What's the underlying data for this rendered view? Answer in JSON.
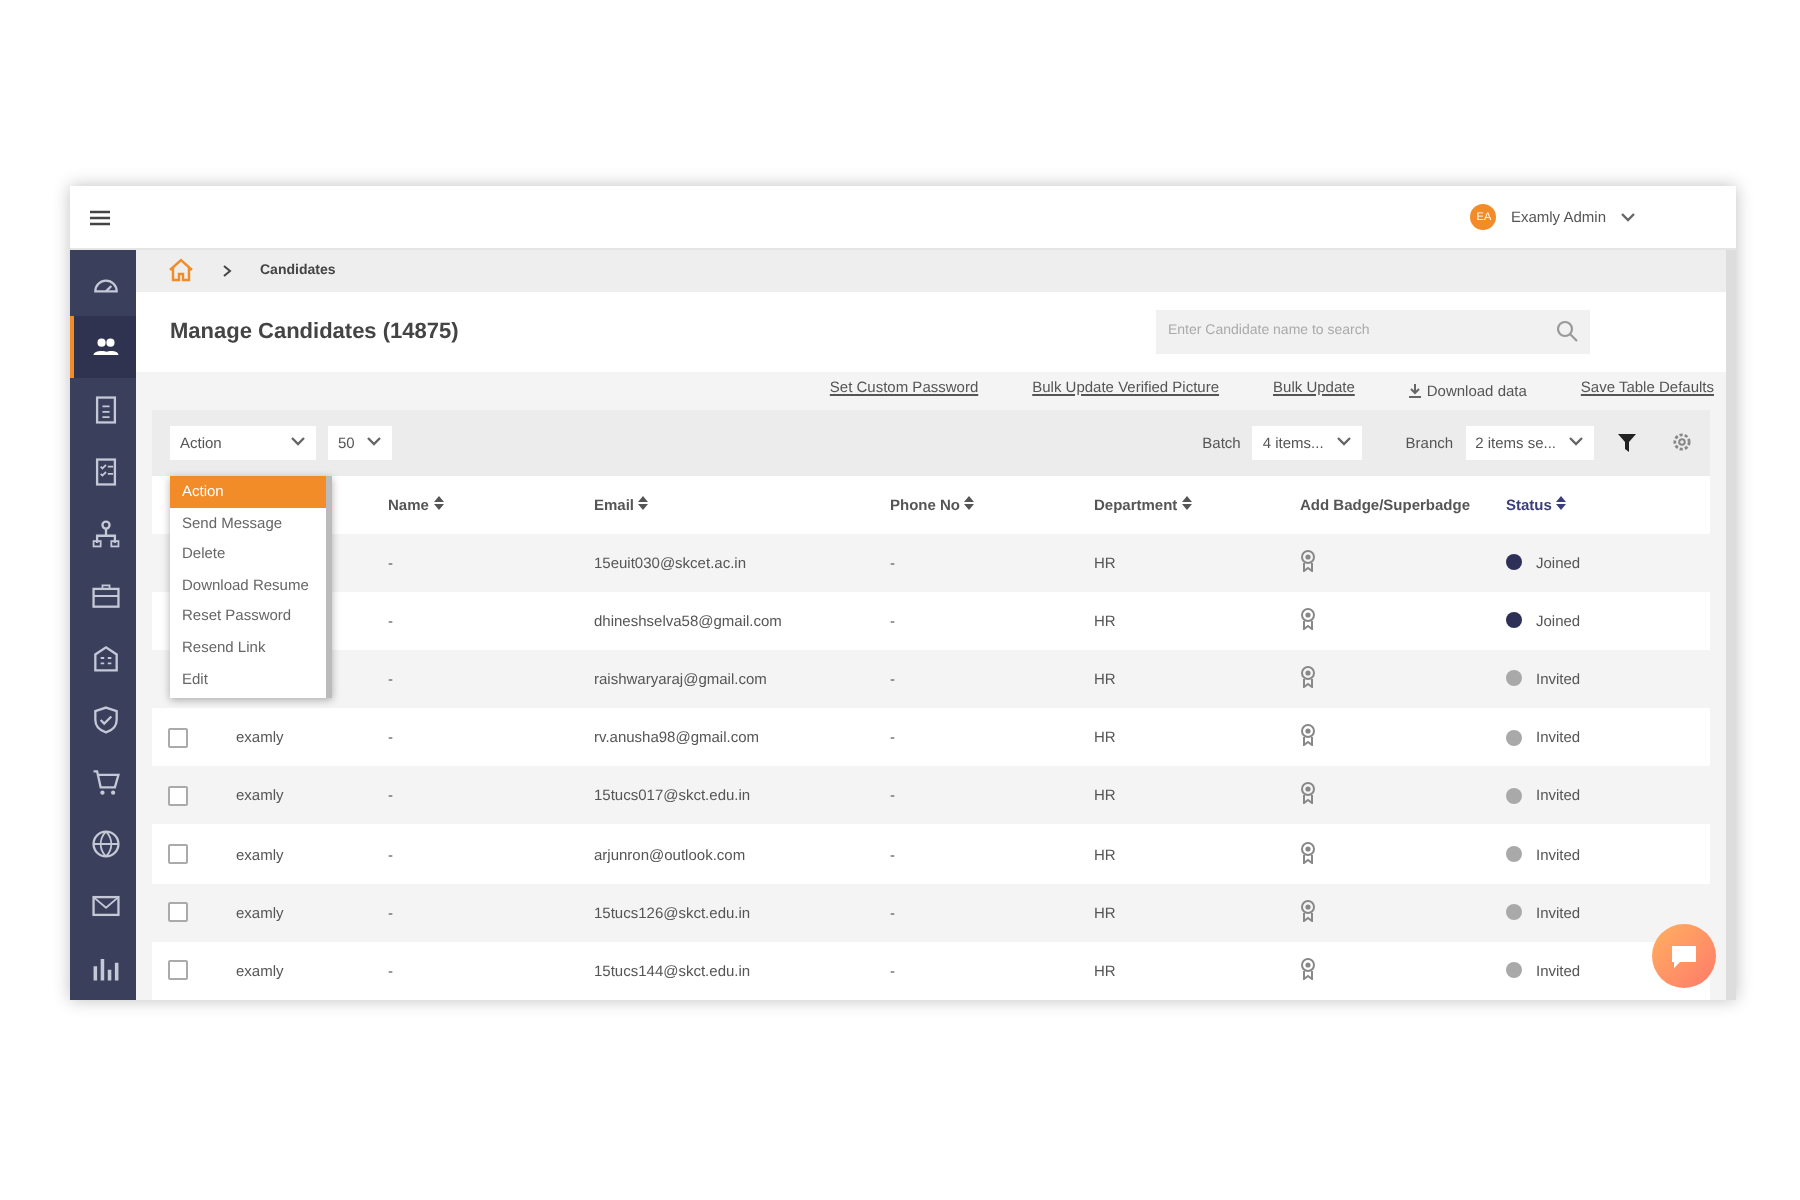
{
  "topbar": {
    "user": {
      "initials": "EA",
      "name": "Examly Admin"
    }
  },
  "sidebar": {
    "items": [
      {
        "kind": "gauge",
        "selected": false
      },
      {
        "kind": "people",
        "selected": true
      },
      {
        "kind": "document",
        "selected": false
      },
      {
        "kind": "checklist",
        "selected": false
      },
      {
        "kind": "hierarchy",
        "selected": false
      },
      {
        "kind": "briefcase",
        "selected": false
      },
      {
        "kind": "building",
        "selected": false
      },
      {
        "kind": "shield",
        "selected": false
      },
      {
        "kind": "cart",
        "selected": false
      },
      {
        "kind": "globe",
        "selected": false
      },
      {
        "kind": "mail",
        "selected": false
      },
      {
        "kind": "chart",
        "selected": false
      }
    ]
  },
  "breadcrumb": {
    "current": "Candidates"
  },
  "page": {
    "title": "Manage Candidates (14875)",
    "search": {
      "placeholder": "Enter Candidate name to search"
    }
  },
  "links": [
    {
      "label": "Set Custom Password",
      "kind": "link"
    },
    {
      "label": "Bulk Update Verified Picture",
      "kind": "link"
    },
    {
      "label": "Bulk Update",
      "kind": "link"
    },
    {
      "label": "Download data",
      "kind": "download"
    },
    {
      "label": "Save Table Defaults",
      "kind": "link"
    }
  ],
  "filters": {
    "action": {
      "value": "Action"
    },
    "page_size": {
      "value": "50"
    },
    "batch": {
      "label": "Batch",
      "value": "4 items..."
    },
    "branch": {
      "label": "Branch",
      "value": "2 items se..."
    }
  },
  "action_menu": {
    "items": [
      {
        "label": "Action",
        "selected": true
      },
      {
        "label": "Send Message",
        "selected": false
      },
      {
        "label": "Delete",
        "selected": false
      },
      {
        "label": "Download Resume",
        "selected": false
      },
      {
        "label": "Reset Password",
        "selected": false
      },
      {
        "label": "Resend Link",
        "selected": false
      },
      {
        "label": "Edit",
        "selected": false
      }
    ]
  },
  "table": {
    "columns": [
      {
        "label": "Name",
        "sortable": true,
        "highlighted": false
      },
      {
        "label": "Email",
        "sortable": true,
        "highlighted": false
      },
      {
        "label": "Phone No",
        "sortable": true,
        "highlighted": false
      },
      {
        "label": "Department",
        "sortable": true,
        "highlighted": false
      },
      {
        "label": "Add Badge/Superbadge",
        "sortable": false,
        "highlighted": false
      },
      {
        "label": "Status",
        "sortable": true,
        "highlighted": true
      }
    ],
    "rows": [
      {
        "name": "-",
        "email": "15euit030@skcet.ac.in",
        "phone": "-",
        "department": "HR",
        "status": "Joined",
        "color": "#2d3057"
      },
      {
        "name": "-",
        "email": "dhineshselva58@gmail.com",
        "phone": "-",
        "department": "HR",
        "status": "Joined",
        "color": "#2d3057"
      },
      {
        "name": "-",
        "email": "raishwaryaraj@gmail.com",
        "phone": "-",
        "department": "HR",
        "status": "Invited",
        "color": "#a9a9a9"
      },
      {
        "checked": false,
        "username": "examly",
        "name": "-",
        "email": "rv.anusha98@gmail.com",
        "phone": "-",
        "department": "HR",
        "status": "Invited",
        "color": "#a9a9a9"
      },
      {
        "checked": false,
        "username": "examly",
        "name": "-",
        "email": "15tucs017@skct.edu.in",
        "phone": "-",
        "department": "HR",
        "status": "Invited",
        "color": "#a9a9a9"
      },
      {
        "checked": false,
        "username": "examly",
        "name": "-",
        "email": "arjunron@outlook.com",
        "phone": "-",
        "department": "HR",
        "status": "Invited",
        "color": "#a9a9a9"
      },
      {
        "checked": false,
        "username": "examly",
        "name": "-",
        "email": "15tucs126@skct.edu.in",
        "phone": "-",
        "department": "HR",
        "status": "Invited",
        "color": "#a9a9a9"
      },
      {
        "checked": false,
        "username": "examly",
        "name": "-",
        "email": "15tucs144@skct.edu.in",
        "phone": "-",
        "department": "HR",
        "status": "Invited",
        "color": "#a9a9a9"
      }
    ]
  }
}
